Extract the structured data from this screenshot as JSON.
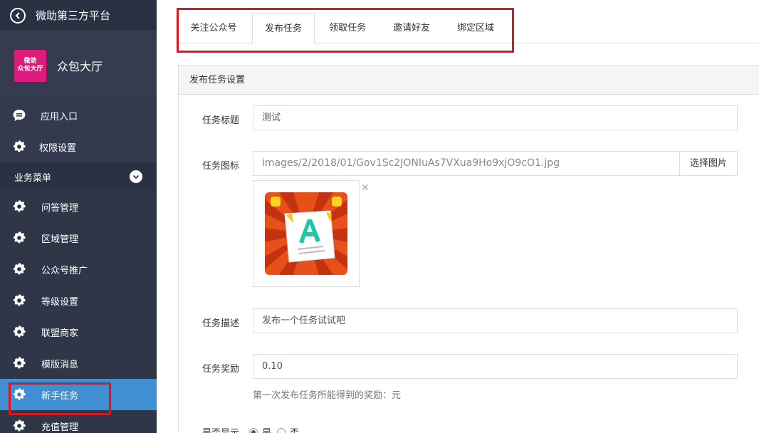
{
  "sidebar": {
    "header_title": "微助第三方平台",
    "app_name": "众包大厅",
    "logo_text_line1": "微助",
    "logo_text_line2": "众包大厅",
    "top_items": [
      {
        "label": "应用入口",
        "icon": "chat-icon"
      },
      {
        "label": "权限设置",
        "icon": "gear-icon"
      }
    ],
    "section_title": "业务菜单",
    "sub_items": [
      {
        "label": "问答管理",
        "icon": "gear-icon"
      },
      {
        "label": "区域管理",
        "icon": "gear-icon"
      },
      {
        "label": "公众号推广",
        "icon": "gear-icon"
      },
      {
        "label": "等级设置",
        "icon": "gear-icon"
      },
      {
        "label": "联盟商家",
        "icon": "gear-icon"
      },
      {
        "label": "模版消息",
        "icon": "gear-icon"
      },
      {
        "label": "新手任务",
        "icon": "gear-icon",
        "active": true
      },
      {
        "label": "充值管理",
        "icon": "gear-icon"
      }
    ]
  },
  "tabs": [
    "关注公众号",
    "发布任务",
    "领取任务",
    "邀请好友",
    "绑定区域"
  ],
  "active_tab": "发布任务",
  "panel": {
    "title": "发布任务设置",
    "fields": {
      "title_label": "任务标题",
      "title_value": "测试",
      "icon_label": "任务图标",
      "icon_path": "images/2/2018/01/Gov1Sc2JONIuAs7VXua9Ho9xjO9cO1.jpg",
      "icon_button": "选择图片",
      "desc_label": "任务描述",
      "desc_value": "发布一个任务试试吧",
      "reward_label": "任务奖励",
      "reward_value": "0.10",
      "reward_help": "第一次发布任务所能得到的奖励：元",
      "show_label": "是否显示",
      "show_yes": "是",
      "show_no": "否"
    }
  },
  "colors": {
    "sidebar_bg": "#2f3648",
    "active_item": "#3f8fd2",
    "highlight_box": "#e0141c",
    "logo_bg": "#e0197d"
  }
}
